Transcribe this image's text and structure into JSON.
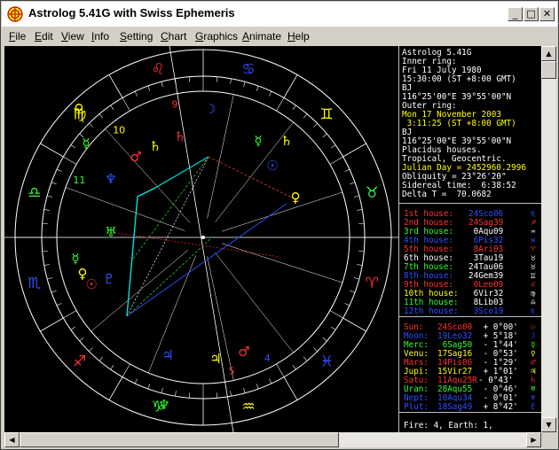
{
  "window": {
    "title": "Astrolog 5.41G with Swiss Ephemeris",
    "minimize_glyph": "_",
    "maximize_glyph": "□",
    "close_glyph": "✕"
  },
  "menu": [
    {
      "label": "File",
      "key": "F",
      "rest": "ile"
    },
    {
      "label": "Edit",
      "key": "E",
      "rest": "dit"
    },
    {
      "label": "View",
      "key": "V",
      "rest": "iew"
    },
    {
      "label": "Info",
      "key": "I",
      "rest": "nfo"
    },
    {
      "label": "Setting",
      "key": "S",
      "rest": "etting"
    },
    {
      "label": "Chart",
      "key": "C",
      "rest": "hart"
    },
    {
      "label": "Graphics",
      "key": "G",
      "rest": "raphics"
    },
    {
      "label": "Animate",
      "key": "A",
      "rest": "nimate"
    },
    {
      "label": "Help",
      "key": "H",
      "rest": "elp"
    }
  ],
  "info_panel": {
    "lines": [
      {
        "text": "Astrolog 5.41G",
        "color": "#ffffff"
      },
      {
        "text": "Inner ring:",
        "color": "#ffffff"
      },
      {
        "text": "Fri 11 July 1980",
        "color": "#ffffff"
      },
      {
        "text": "15:30:00 (ST +8:00 GMT)",
        "color": "#ffffff"
      },
      {
        "text": "BJ",
        "color": "#ffffff"
      },
      {
        "text": "116°25'00\"E 39°55'00\"N",
        "color": "#ffffff"
      },
      {
        "text": "Outer ring:",
        "color": "#ffffff"
      },
      {
        "text": "Mon 17 November 2003",
        "color": "#ffff00"
      },
      {
        "text": " 3:11:25 (ST +8:00 GMT)",
        "color": "#ffff00"
      },
      {
        "text": "BJ",
        "color": "#ffffff"
      },
      {
        "text": "116°25'00\"E 39°55'00\"N",
        "color": "#ffffff"
      },
      {
        "text": "Placidus houses.",
        "color": "#ffffff"
      },
      {
        "text": "Tropical, Geocentric.",
        "color": "#ffffff"
      },
      {
        "text": "Julian Day = 2452960.2996",
        "color": "#ffff00"
      },
      {
        "text": "Obliquity = 23°26'20\"",
        "color": "#ffffff"
      },
      {
        "text": "Sidereal time:  6:38:52",
        "color": "#ffffff"
      },
      {
        "text": "Delta T =  70.0682",
        "color": "#ffffff"
      }
    ],
    "houses": [
      {
        "label": "1st house:",
        "sign": "24Sco06",
        "color": "#ff3030",
        "sign_color": "#3050ff",
        "glyph": "♏"
      },
      {
        "label": "2nd house:",
        "sign": "24Sag39",
        "color": "#ff3030",
        "sign_color": "#ff3030",
        "glyph": "♐"
      },
      {
        "label": "3rd house:",
        "sign": " 0Aqu09",
        "color": "#30ff30",
        "sign_color": "#ffffff",
        "glyph": "♒"
      },
      {
        "label": "4th house:",
        "sign": " 6Pis32",
        "color": "#3050ff",
        "sign_color": "#3050ff",
        "glyph": "♓"
      },
      {
        "label": "5th house:",
        "sign": " 8Ari03",
        "color": "#ff3030",
        "sign_color": "#ff3030",
        "glyph": "♈"
      },
      {
        "label": "6th house:",
        "sign": " 3Tau19",
        "color": "#ffffff",
        "sign_color": "#ffffff",
        "glyph": "♉"
      },
      {
        "label": "7th house:",
        "sign": "24Tau06",
        "color": "#30ff30",
        "sign_color": "#ffffff",
        "glyph": "♉"
      },
      {
        "label": "8th house:",
        "sign": "24Gem39",
        "color": "#3050ff",
        "sign_color": "#ffffff",
        "glyph": "♊"
      },
      {
        "label": "9th house:",
        "sign": " 0Leo09",
        "color": "#ff3030",
        "sign_color": "#ff3030",
        "glyph": "♌"
      },
      {
        "label": "10th house:",
        "sign": " 6Vir32",
        "color": "#ffff00",
        "sign_color": "#ffffff",
        "glyph": "♍"
      },
      {
        "label": "11th house:",
        "sign": " 8Lib03",
        "color": "#30ff30",
        "sign_color": "#ffffff",
        "glyph": "♎"
      },
      {
        "label": "12th house:",
        "sign": " 3Sco19",
        "color": "#3050ff",
        "sign_color": "#3050ff",
        "glyph": "♏"
      }
    ],
    "planets": [
      {
        "label": "Sun:",
        "pos": "24Sco00",
        "extra": " + 0°00'",
        "color": "#ff3030",
        "glyph": "☉"
      },
      {
        "label": "Moon:",
        "pos": "19Leo32",
        "extra": " + 5°18'",
        "color": "#3050ff",
        "glyph": "☽"
      },
      {
        "label": "Merc:",
        "pos": " 6Sag50",
        "extra": " - 1°44'",
        "color": "#30ff30",
        "glyph": "☿"
      },
      {
        "label": "Venu:",
        "pos": "17Sag16",
        "extra": " - 0°53'",
        "color": "#ffff00",
        "glyph": "♀"
      },
      {
        "label": "Mars:",
        "pos": "14Pis06",
        "extra": " - 1°29'",
        "color": "#ff3030",
        "glyph": "♂"
      },
      {
        "label": "Jupi:",
        "pos": "15Vir27",
        "extra": " + 1°01'",
        "color": "#ffff00",
        "glyph": "♃"
      },
      {
        "label": "Satu:",
        "pos": "11Aqu25R",
        "extra": "- 0°43'",
        "color": "#ff3030",
        "glyph": "♄"
      },
      {
        "label": "Uran:",
        "pos": "28Aqu55",
        "extra": " - 0°46'",
        "color": "#30ff30",
        "glyph": "♅"
      },
      {
        "label": "Nept:",
        "pos": "10Aqu34",
        "extra": " - 0°01'",
        "color": "#3050ff",
        "glyph": "♆"
      },
      {
        "label": "Plut:",
        "pos": "18Sag49",
        "extra": " + 8°42'",
        "color": "#3050ff",
        "glyph": "♇"
      }
    ],
    "footer": "Fire: 4, Earth: 1,"
  },
  "wheel": {
    "signs": [
      {
        "glyph": "♌",
        "color": "#ff3030",
        "lon": 105
      },
      {
        "glyph": "♋",
        "color": "#3050ff",
        "lon": 75
      },
      {
        "glyph": "♊",
        "color": "#ffff00",
        "lon": 45
      },
      {
        "glyph": "♉",
        "color": "#30ff30",
        "lon": 15
      },
      {
        "glyph": "♈",
        "color": "#ff3030",
        "lon": -15
      },
      {
        "glyph": "♓",
        "color": "#3050ff",
        "lon": -45
      },
      {
        "glyph": "♒",
        "color": "#ffff00",
        "lon": -75
      },
      {
        "glyph": "♑",
        "color": "#30ff30",
        "lon": -105
      },
      {
        "glyph": "♐",
        "color": "#ff3030",
        "lon": -135
      },
      {
        "glyph": "♏",
        "color": "#3050ff",
        "lon": -165
      },
      {
        "glyph": "♎",
        "color": "#30ff30",
        "lon": 165
      },
      {
        "glyph": "♍",
        "color": "#ffff00",
        "lon": 135
      }
    ],
    "house_numbers": [
      {
        "n": "9",
        "color": "#ff3030",
        "lon": 102
      },
      {
        "n": "10",
        "color": "#ffff00",
        "lon": 128
      },
      {
        "n": "11",
        "color": "#30ff30",
        "lon": 155
      },
      {
        "n": "4",
        "color": "#3050ff",
        "lon": -62
      },
      {
        "n": "5",
        "color": "#ff3030",
        "lon": -78
      }
    ]
  }
}
